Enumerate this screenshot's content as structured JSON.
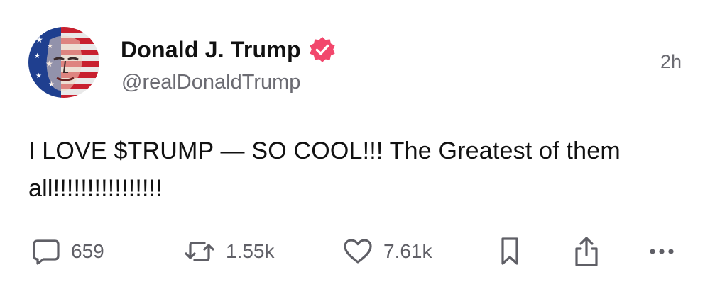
{
  "post": {
    "author": {
      "display_name": "Donald J. Trump",
      "handle": "@realDonaldTrump",
      "verified": true,
      "verified_color": "#f2476c"
    },
    "timestamp": "2h",
    "text": "I LOVE $TRUMP — SO COOL!!! The Greatest of them all!!!!!!!!!!!!!!!!",
    "actions": {
      "reply": {
        "icon": "comment-icon",
        "count": "659"
      },
      "repost": {
        "icon": "repost-icon",
        "count": "1.55k"
      },
      "like": {
        "icon": "heart-icon",
        "count": "7.61k"
      },
      "save": {
        "icon": "bookmark-icon"
      },
      "share": {
        "icon": "share-icon"
      },
      "more": {
        "icon": "more-icon"
      }
    }
  },
  "colors": {
    "text_primary": "#111111",
    "text_secondary": "#6b6b72",
    "icon": "#5f5f66"
  }
}
